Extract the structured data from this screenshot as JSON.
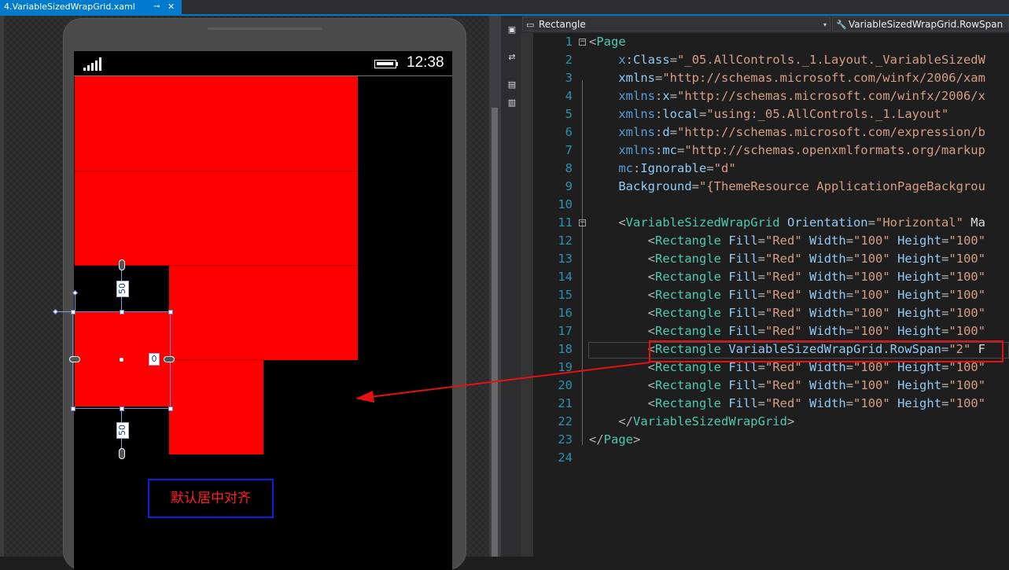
{
  "tab": {
    "title": "4.VariableSizedWrapGrid.xaml",
    "pin_glyph": "⊸",
    "close_glyph": "✕"
  },
  "designer": {
    "clock": "12:38",
    "margin_top": "50",
    "margin_bottom": "50",
    "margin_right": "0",
    "annotation": "默认居中对齐",
    "annotation_color": "#ff2020",
    "rect_fill": "#ff0000"
  },
  "navbar": {
    "left_dropdown": "Rectangle",
    "right_dropdown": "VariableSizedWrapGrid.RowSpan"
  },
  "code_lines": [
    {
      "n": "1",
      "text": "<Page"
    },
    {
      "n": "2",
      "text": "    x:Class=\"_05.AllControls._1.Layout._VariableSizedW"
    },
    {
      "n": "3",
      "text": "    xmlns=\"http://schemas.microsoft.com/winfx/2006/xam"
    },
    {
      "n": "4",
      "text": "    xmlns:x=\"http://schemas.microsoft.com/winfx/2006/x"
    },
    {
      "n": "5",
      "text": "    xmlns:local=\"using:_05.AllControls._1.Layout\""
    },
    {
      "n": "6",
      "text": "    xmlns:d=\"http://schemas.microsoft.com/expression/b"
    },
    {
      "n": "7",
      "text": "    xmlns:mc=\"http://schemas.openxmlformats.org/markup"
    },
    {
      "n": "8",
      "text": "    mc:Ignorable=\"d\""
    },
    {
      "n": "9",
      "text": "    Background=\"{ThemeResource ApplicationPageBackgrou"
    },
    {
      "n": "10",
      "text": ""
    },
    {
      "n": "11",
      "text": "    <VariableSizedWrapGrid Orientation=\"Horizontal\" Ma"
    },
    {
      "n": "12",
      "text": "        <Rectangle Fill=\"Red\" Width=\"100\" Height=\"100\""
    },
    {
      "n": "13",
      "text": "        <Rectangle Fill=\"Red\" Width=\"100\" Height=\"100\""
    },
    {
      "n": "14",
      "text": "        <Rectangle Fill=\"Red\" Width=\"100\" Height=\"100\""
    },
    {
      "n": "15",
      "text": "        <Rectangle Fill=\"Red\" Width=\"100\" Height=\"100\""
    },
    {
      "n": "16",
      "text": "        <Rectangle Fill=\"Red\" Width=\"100\" Height=\"100\""
    },
    {
      "n": "17",
      "text": "        <Rectangle Fill=\"Red\" Width=\"100\" Height=\"100\""
    },
    {
      "n": "18",
      "text": "        <Rectangle VariableSizedWrapGrid.RowSpan=\"2\" F"
    },
    {
      "n": "19",
      "text": "        <Rectangle Fill=\"Red\" Width=\"100\" Height=\"100\""
    },
    {
      "n": "20",
      "text": "        <Rectangle Fill=\"Red\" Width=\"100\" Height=\"100\""
    },
    {
      "n": "21",
      "text": "        <Rectangle Fill=\"Red\" Width=\"100\" Height=\"100\""
    },
    {
      "n": "22",
      "text": "    </VariableSizedWrapGrid>"
    },
    {
      "n": "23",
      "text": "</Page>"
    },
    {
      "n": "24",
      "text": ""
    }
  ],
  "colors": {
    "tab_accent": "#007acc",
    "line_number": "#2b91af",
    "xml_tag": "#569cd6",
    "xml_attr": "#92caf4",
    "xml_value": "#d69d85",
    "callout_red": "#e81010",
    "note_border": "#0a1ee8"
  }
}
